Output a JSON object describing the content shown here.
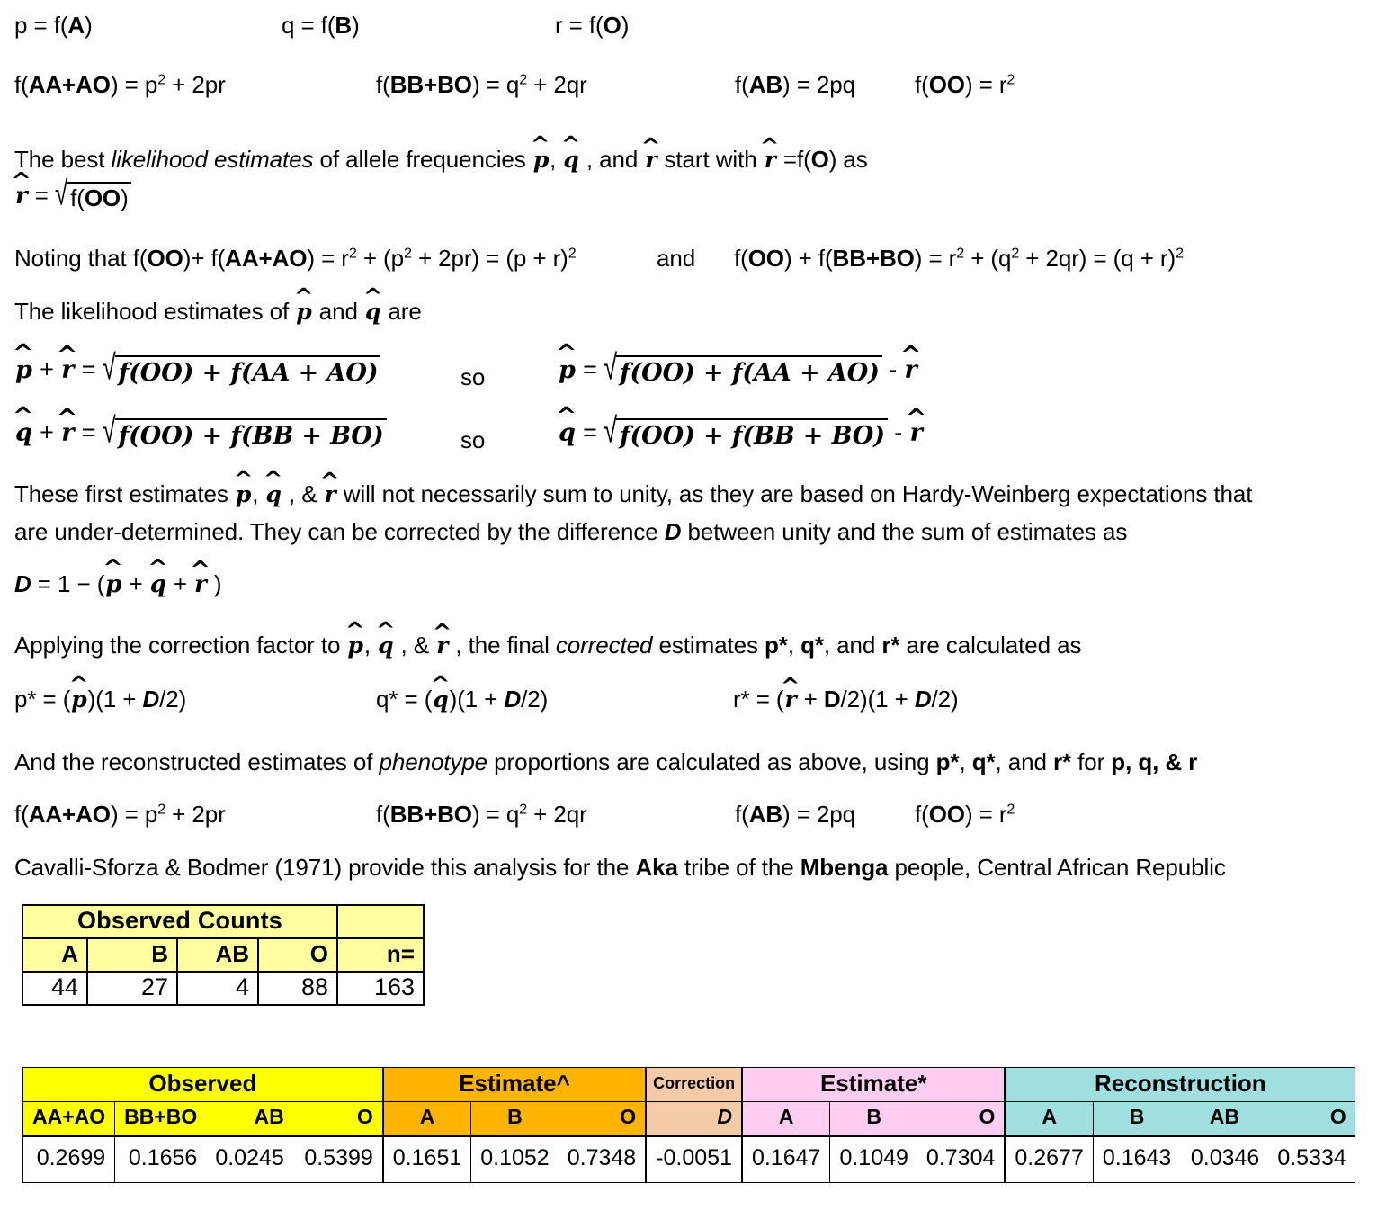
{
  "document": {
    "title": "ABO blood group allele frequency maximum-likelihood estimation",
    "lines": {
      "l1_p": "p = f(",
      "l1_pA": "A",
      "l1_pClose": ")",
      "l1_q": "q = f(",
      "l1_qB": "B",
      "l1_qClose": ")",
      "l1_r": "r = f(",
      "l1_rO": "O",
      "l1_rClose": ")",
      "l2_a_pre": "f(",
      "l2_a_bold": "AA+AO",
      "l2_a_post": ") = p",
      "l2_a_sup": "2",
      "l2_a_tail": " + 2pr",
      "l2_b_pre": "f(",
      "l2_b_bold": "BB+BO",
      "l2_b_post": ") = q",
      "l2_b_sup": "2",
      "l2_b_tail": " + 2qr",
      "l2_c_pre": "f(",
      "l2_c_bold": "AB",
      "l2_c_post": ") = 2pq",
      "l2_d_pre": "f(",
      "l2_d_bold": "OO",
      "l2_d_post": ") = r",
      "l2_d_sup": "2",
      "l3_part1": "The best ",
      "l3_italic": "likelihood estimates",
      "l3_part2": " of allele frequencies ",
      "l3_phat": "p̂",
      "l3_comma": ", ",
      "l3_qhat": "q̂",
      "l3_part3": " , and ",
      "l3_rhat": "r̂",
      "l3_part4": " start with ",
      "l3_rhat2": "r̂",
      "l3_part5": " =f(",
      "l3_O": "O",
      "l3_part6": ") as",
      "l4_lhs": "r̂",
      "l4_eq": " = ",
      "l4_radicand_pre": "f(",
      "l4_radicand_bold": "OO",
      "l4_radicand_post": ")",
      "l5_pre": "Noting that f(",
      "l5_OO": "OO",
      "l5_mid1": ")+ f(",
      "l5_AAAO": "AA+AO",
      "l5_mid2": ") = r",
      "l5_sup1": "2",
      "l5_mid3": " + (p",
      "l5_sup2": "2",
      "l5_mid4": " + 2pr) = (p + r)",
      "l5_sup3": "2",
      "l5_and": "and",
      "l5_b_pre": "f(",
      "l5_b_OO": "OO",
      "l5_b_mid1": ") + f(",
      "l5_b_BBBO": "BB+BO",
      "l5_b_mid2": ") = r",
      "l5_b_sup1": "2",
      "l5_b_mid3": " + (q",
      "l5_b_sup2": "2",
      "l5_b_mid4": " + 2qr) = (q + r)",
      "l5_b_sup3": "2",
      "l6_part1": "The likelihood estimates of ",
      "l6_phat": "p̂",
      "l6_part2": " and ",
      "l6_qhat": "q̂",
      "l6_part3": " are",
      "eq_p_lhs_p": "p̂",
      "eq_p_lhs_plus": " + ",
      "eq_p_lhs_r": "r̂",
      "eq_p_lhs_eq": " = ",
      "eq_p_rad_f1": "f",
      "eq_p_rad_oo": "(OO)",
      "eq_p_rad_plus": " + ",
      "eq_p_rad_f2": "f",
      "eq_p_rad_aaao": "(AA + AO)",
      "eq_so": "so",
      "eq_p2_lhs": "p̂",
      "eq_p2_eq": " = ",
      "eq_p2_minus": " - ",
      "eq_p2_rhat": "r̂",
      "eq_q_lhs_q": "q̂",
      "eq_q_rad_bbbo": "(BB + BO)",
      "eq_q2_lhs": "q̂",
      "l7_part1": "These first estimates ",
      "l7_phat": "p̂",
      "l7_c1": ", ",
      "l7_qhat": "q̂",
      "l7_c2": " , & ",
      "l7_rhat": "r̂",
      "l7_part2": " will not necessarily sum to unity, as they are based on Hardy-Weinberg expectations that",
      "l7_line2a": "are under-determined. They can be corrected by the difference ",
      "l7_D": "D",
      "l7_line2b": " between unity and the sum of estimates as",
      "l8_D": "D",
      "l8_eq": " = 1 − (",
      "l8_phat": "p̂",
      "l8_plus1": " + ",
      "l8_qhat": "q̂",
      "l8_plus2": " + ",
      "l8_rhat": "r̂",
      "l8_close": " )",
      "l9_part1": "Applying the correction factor to ",
      "l9_phat": "p̂",
      "l9_c1": ", ",
      "l9_qhat": "q̂",
      "l9_c2": " , & ",
      "l9_rhat": "r̂",
      "l9_part2": " , the final ",
      "l9_italic": "corrected",
      "l9_part3": " estimates ",
      "l9_pstar": "p*",
      "l9_comma1": ", ",
      "l9_qstar": "q*",
      "l9_and": ", and ",
      "l9_rstar": "r*",
      "l9_part4": " are calculated as",
      "l10_a_lead": "p* = (",
      "l10_a_hat": "p̂",
      "l10_a_mid": ")(1 + ",
      "l10_a_D": "D",
      "l10_a_tail": "/2)",
      "l10_b_lead": "q* = (",
      "l10_b_hat": "q̂",
      "l10_b_mid": ")(1 + ",
      "l10_b_D": "D",
      "l10_b_tail": "/2)",
      "l10_c_lead": "r* = (",
      "l10_c_hat": "r̂",
      "l10_c_mid": " + ",
      "l10_c_D1": "D",
      "l10_c_mid2": "/2)(1 + ",
      "l10_c_D2": "D",
      "l10_c_tail": "/2)",
      "l11_part1": "And the reconstructed estimates of ",
      "l11_italic": "phenotype",
      "l11_part2": " proportions are calculated as above, using ",
      "l11_pstar": "p*",
      "l11_c1": ", ",
      "l11_qstar": "q*",
      "l11_and": ", and ",
      "l11_rstar": "r*",
      "l11_part3": " for ",
      "l11_pqr": "p, q, & r",
      "l13_part1": "Cavalli-Sforza & Bodmer (1971) provide this analysis for the ",
      "l13_aka": "Aka",
      "l13_part2": " tribe of the ",
      "l13_mbenga": "Mbenga",
      "l13_part3": " people,  Central African Republic"
    }
  },
  "counts_table": {
    "title": "Observed Counts",
    "headers": [
      "A",
      "B",
      "AB",
      "O"
    ],
    "total_header": "n=",
    "values": [
      "44",
      "27",
      "4",
      "88"
    ],
    "total": "163",
    "colors": {
      "header_bg": "#FFFFA0",
      "value_bg": "#FFFFFF"
    }
  },
  "results_table": {
    "groups": [
      {
        "label": "Observed",
        "color": "#FFFF00",
        "columns": [
          "AA+AO",
          "BB+BO",
          "AB",
          "O"
        ],
        "values": [
          "0.2699",
          "0.1656",
          "0.0245",
          "0.5399"
        ]
      },
      {
        "label": "Estimate^",
        "color": "#FFB400",
        "columns": [
          "A",
          "B",
          "O"
        ],
        "values": [
          "0.1651",
          "0.1052",
          "0.7348"
        ]
      },
      {
        "label": "Correction",
        "color": "#F5CBA7",
        "columns": [
          "D"
        ],
        "values": [
          "-0.0051"
        ]
      },
      {
        "label": "Estimate*",
        "color": "#FFCCF2",
        "columns": [
          "A",
          "B",
          "O"
        ],
        "values": [
          "0.1647",
          "0.1049",
          "0.7304"
        ]
      },
      {
        "label": "Reconstruction",
        "color": "#9FDFDF",
        "columns": [
          "A",
          "B",
          "AB",
          "O"
        ],
        "values": [
          "0.2677",
          "0.1643",
          "0.0346",
          "0.5334"
        ]
      }
    ]
  }
}
